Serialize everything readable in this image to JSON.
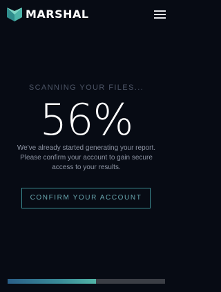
{
  "header": {
    "brand": "MARSHAL",
    "logo_icon": "marshal-shield-logo",
    "menu_icon": "hamburger-menu-icon"
  },
  "scan": {
    "status_text": "SCANNING YOUR FILES...",
    "percent_label": "56%",
    "progress_fraction": 0.56
  },
  "message": {
    "text": "We've already started generating your report. Please confirm your account to gain secure access to your results."
  },
  "cta": {
    "label": "CONFIRM YOUR ACCOUNT"
  },
  "colors": {
    "background": "#070b14",
    "accent": "#3a8c98",
    "progress_track": "#3b3e45"
  }
}
